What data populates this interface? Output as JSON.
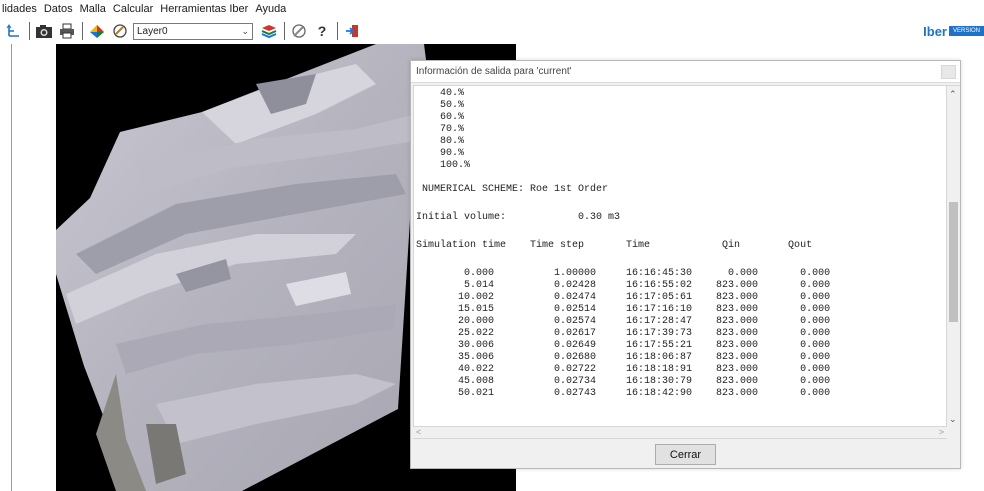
{
  "menu": [
    "lidades",
    "Datos",
    "Malla",
    "Calcular",
    "Herramientas Iber",
    "Ayuda"
  ],
  "toolbar": {
    "layer_value": "Layer0",
    "icons": [
      "axes-icon",
      "camera-icon",
      "print-icon",
      "color-wheel-icon",
      "draw-icon",
      "layers-icon",
      "edit-icon",
      "help-icon",
      "exit-icon"
    ]
  },
  "brand": {
    "logo": "Iber",
    "version": "VERSION"
  },
  "dialog": {
    "title": "Información de salida para 'current'",
    "close_label": "Cerrar",
    "progress": [
      "40.%",
      "50.%",
      "60.%",
      "70.%",
      "80.%",
      "90.%",
      "100.%"
    ],
    "scheme": "NUMERICAL SCHEME: Roe 1st Order",
    "initial_volume_label": "Initial volume:",
    "initial_volume_value": "0.30 m3",
    "columns": [
      "Simulation time",
      "Time step",
      "Time",
      "Qin",
      "Qout"
    ],
    "rows": [
      [
        "0.000",
        "1.00000",
        "16:16:45:30",
        "0.000",
        "0.000"
      ],
      [
        "5.014",
        "0.02428",
        "16:16:55:02",
        "823.000",
        "0.000"
      ],
      [
        "10.002",
        "0.02474",
        "16:17:05:61",
        "823.000",
        "0.000"
      ],
      [
        "15.015",
        "0.02514",
        "16:17:16:10",
        "823.000",
        "0.000"
      ],
      [
        "20.000",
        "0.02574",
        "16:17:28:47",
        "823.000",
        "0.000"
      ],
      [
        "25.022",
        "0.02617",
        "16:17:39:73",
        "823.000",
        "0.000"
      ],
      [
        "30.006",
        "0.02649",
        "16:17:55:21",
        "823.000",
        "0.000"
      ],
      [
        "35.006",
        "0.02680",
        "16:18:06:87",
        "823.000",
        "0.000"
      ],
      [
        "40.022",
        "0.02722",
        "16:18:18:91",
        "823.000",
        "0.000"
      ],
      [
        "45.008",
        "0.02734",
        "16:18:30:79",
        "823.000",
        "0.000"
      ],
      [
        "50.021",
        "0.02743",
        "16:18:42:90",
        "823.000",
        "0.000"
      ]
    ]
  }
}
